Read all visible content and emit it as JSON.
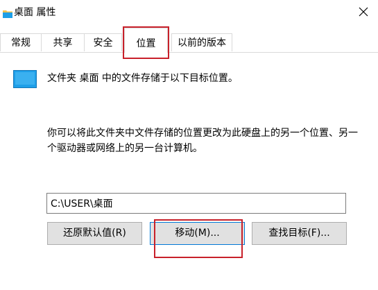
{
  "window": {
    "title": "桌面 属性"
  },
  "tabs": [
    {
      "label": "常规"
    },
    {
      "label": "共享"
    },
    {
      "label": "安全"
    },
    {
      "label": "位置"
    },
    {
      "label": "以前的版本"
    }
  ],
  "location": {
    "text": "文件夹 桌面 中的文件存储于以下目标位置。",
    "description": "你可以将此文件夹中文件存储的位置更改为此硬盘上的另一个位置、另一个驱动器或网络上的另一台计算机。",
    "path_value": "C:\\USER\\桌面"
  },
  "buttons": {
    "restore_label": "还原默认值(R)",
    "move_label": "移动(M)...",
    "find_target_label": "查找目标(F)..."
  },
  "colors": {
    "highlight": "#c8202a",
    "folder_blue": "#1e9fe8",
    "button_bg": "#e1e1e1",
    "focus_border": "#0078d7"
  },
  "icons": {
    "title": "folder-icon",
    "close": "close-icon",
    "location": "desktop-folder-icon"
  }
}
